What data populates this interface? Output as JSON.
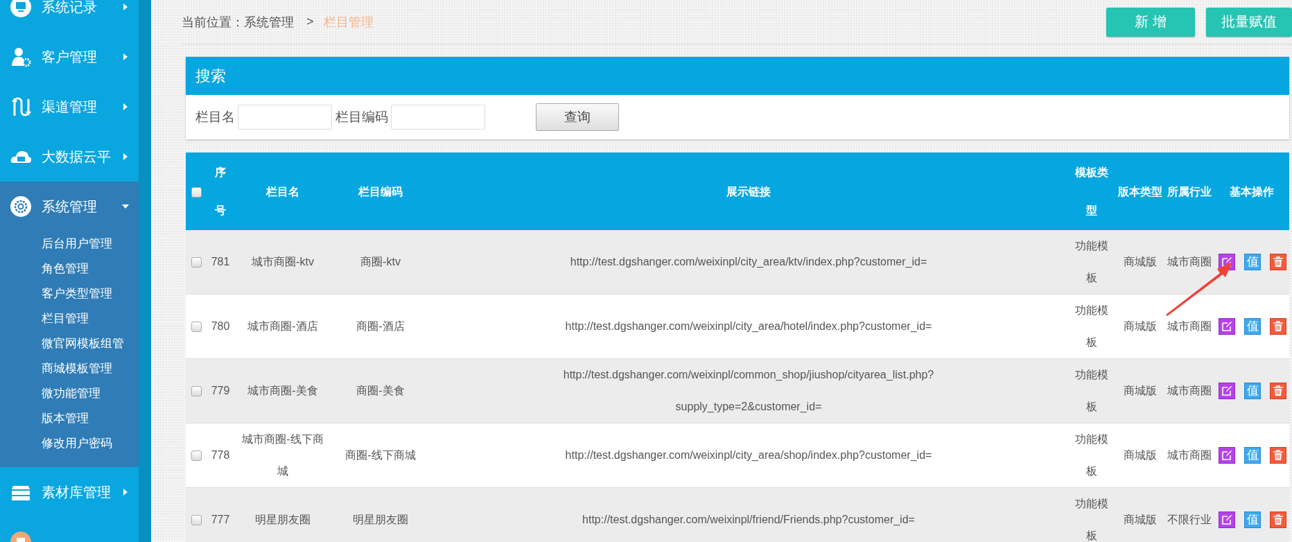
{
  "sidebar": {
    "items": [
      {
        "label": "系统记录",
        "kind": "monitor",
        "expanded": false
      },
      {
        "label": "客户管理",
        "kind": "user",
        "expanded": false
      },
      {
        "label": "渠道管理",
        "kind": "arrows",
        "expanded": false
      },
      {
        "label": "大数据云平",
        "kind": "cloud",
        "expanded": false
      },
      {
        "label": "系统管理",
        "kind": "gear",
        "expanded": true,
        "children": [
          {
            "label": "后台用户管理"
          },
          {
            "label": "角色管理"
          },
          {
            "label": "客户类型管理"
          },
          {
            "label": "栏目管理"
          },
          {
            "label": "微官网模板组管"
          },
          {
            "label": "商城模板管理"
          },
          {
            "label": "微功能管理"
          },
          {
            "label": "版本管理"
          },
          {
            "label": "修改用户密码"
          }
        ]
      },
      {
        "label": "素材库管理",
        "kind": "layers",
        "expanded": false
      },
      {
        "kind": "circle"
      }
    ]
  },
  "breadcrumb": {
    "prefix": "当前位置：系统管理",
    "separator": ">",
    "current": "栏目管理"
  },
  "toolbar": {
    "buttons": [
      "新 增",
      "批量赋值"
    ]
  },
  "search": {
    "title": "搜索",
    "fields": [
      {
        "label": "栏目名"
      },
      {
        "label": "栏目编码"
      }
    ],
    "button": "查询"
  },
  "table": {
    "header_checked": false,
    "columns": [
      "序号",
      "栏目名",
      "栏目编码",
      "展示链接",
      "模板类型",
      "版本类型",
      "所属行业",
      "基本操作"
    ],
    "rows": [
      {
        "checked": false,
        "seq": "781",
        "name": "城市商圈-ktv",
        "code": "商圈-ktv",
        "link": "http://test.dgshanger.com/weixinpl/city_area/ktv/index.php?customer_id=",
        "template_type": "功能模板",
        "version": "商城版",
        "industry": "城市商圈",
        "assign_label": "值"
      },
      {
        "checked": false,
        "seq": "780",
        "name": "城市商圈-酒店",
        "code": "商圈-酒店",
        "link": "http://test.dgshanger.com/weixinpl/city_area/hotel/index.php?customer_id=",
        "template_type": "功能模板",
        "version": "商城版",
        "industry": "城市商圈",
        "assign_label": "值"
      },
      {
        "checked": false,
        "seq": "779",
        "name": "城市商圈-美食",
        "code": "商圈-美食",
        "link": "http://test.dgshanger.com/weixinpl/common_shop/jiushop/cityarea_list.php?supply_type=2&customer_id=",
        "template_type": "功能模板",
        "version": "商城版",
        "industry": "城市商圈",
        "assign_label": "值"
      },
      {
        "checked": false,
        "seq": "778",
        "name": "城市商圈-线下商城",
        "code": "商圈-线下商城",
        "link": "http://test.dgshanger.com/weixinpl/city_area/shop/index.php?customer_id=",
        "template_type": "功能模板",
        "version": "商城版",
        "industry": "城市商圈",
        "assign_label": "值"
      },
      {
        "checked": false,
        "seq": "777",
        "name": "明星朋友圈",
        "code": "明星朋友圈",
        "link": "http://test.dgshanger.com/weixinpl/friend/Friends.php?customer_id=",
        "template_type": "功能模板",
        "version": "商城版",
        "industry": "不限行业",
        "assign_label": "值"
      }
    ]
  }
}
